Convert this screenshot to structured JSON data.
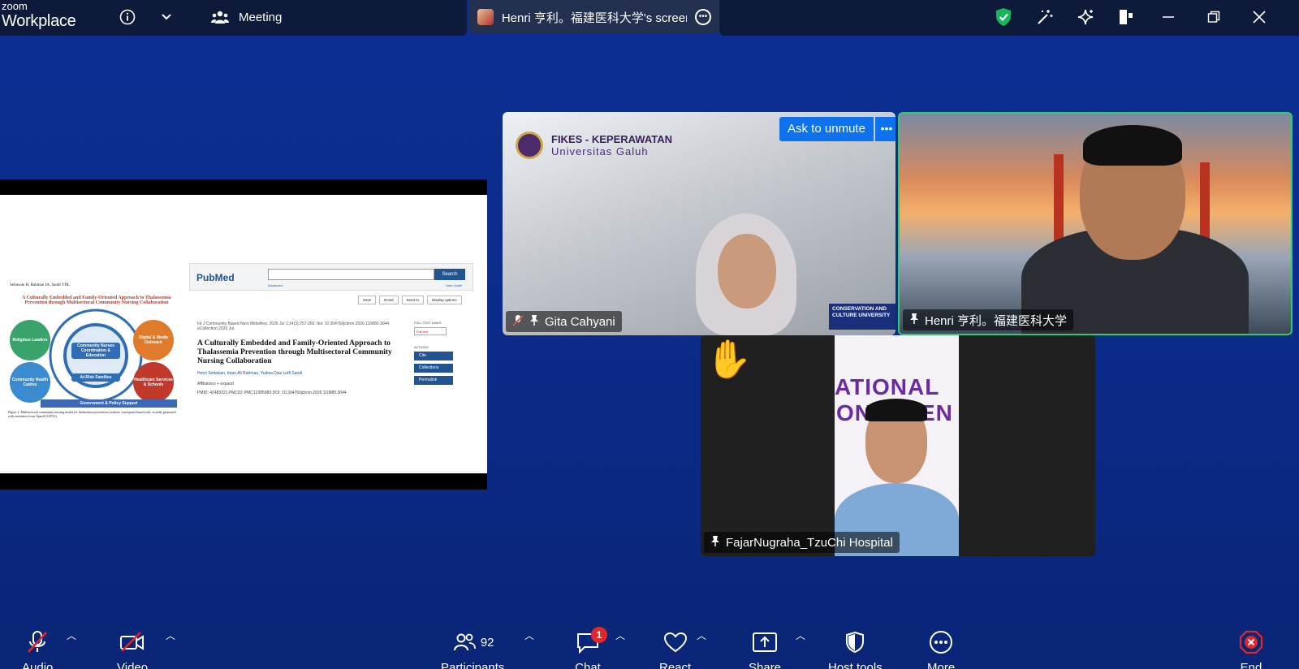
{
  "app": {
    "logo_top": "zoom",
    "logo_bottom": "Workplace"
  },
  "topbar": {
    "meeting_label": "Meeting",
    "share_tab_label": "Henri 亨利。福建医科大学's screen"
  },
  "shared_screen": {
    "figure_authors": "Setiawan H, Rahman IA, Sandi YDL",
    "figure_title": "A Culturally Embedded and Family-Oriented Approach to Thalassemia Prevention through Multisectoral Community Nursing Collaboration",
    "nodes": [
      {
        "label": "Religious Leaders",
        "color": "#3aa36b"
      },
      {
        "label": "Digital & Media Outreach",
        "color": "#e07b2c"
      },
      {
        "label": "Community Nurses Coordination & Education",
        "color": "#2f6db5"
      },
      {
        "label": "Community Health Cadres",
        "color": "#3a8bd0"
      },
      {
        "label": "At-Risk Families",
        "color": "#2f6db5"
      },
      {
        "label": "Healthcare Services & Schools",
        "color": "#c0392b"
      }
    ],
    "figure_bar": "Government & Policy Support",
    "figure_caption": "Figure 1: Multisectoral community nursing model for thalassemia prevention (authors' conceptual framework, visually generated with assistance from OpenAI GPT-4)",
    "pubmed": {
      "logo": "PubMed",
      "search_button": "Search",
      "advanced": "Advanced",
      "user_guide": "User Guide",
      "tools": [
        "Save",
        "Email",
        "Send to",
        "Display options"
      ],
      "journal_line": "Int J Community Based Nurs Midwifery. 2026 Jul 1;14(3):257-260. doi: 10.30476/ijcbnm.2026.110880.3044. eCollection 2026 Jul.",
      "title": "A Culturally Embedded and Family-Oriented Approach to Thalassemia Prevention through Multisectoral Community Nursing Collaboration",
      "authors": "Henri Setiawan, Irpan Ali Rahman, Yudisa Diaz Lutfi Sandi",
      "affiliations": "Affiliations + expand",
      "ids": "PMID: 42483321   PMCID: PMC12385983   DOI: 10.30476/ijcbnm.2026.110880.3044",
      "full_text_label": "FULL TEXT LINKS",
      "full_text_btn": "Full text",
      "actions_label": "ACTIONS",
      "actions": [
        "Cite",
        "Collections",
        "Permalink"
      ]
    }
  },
  "tiles": {
    "gita": {
      "name": "Gita Cahyani",
      "org_line1": "FIKES - KEPERAWATAN",
      "org_line2": "Universitas Galuh",
      "ask_unmute": "Ask to unmute",
      "banner": "CONSERVATION AND CULTURE UNIVERSITY"
    },
    "henri": {
      "name": "Henri 亨利。福建医科大学"
    },
    "fajar": {
      "name": "FajarNugraha_TzuChi Hospital",
      "poster_line1": "ATIONAL",
      "poster_line2": "ONFEREN"
    }
  },
  "toolbar": {
    "audio": "Audio",
    "video": "Video",
    "participants": "Participants",
    "participants_count": "92",
    "chat": "Chat",
    "chat_badge": "1",
    "react": "React",
    "share": "Share",
    "host_tools": "Host tools",
    "more": "More",
    "end": "End"
  },
  "colors": {
    "background": "#0c2f95",
    "topbar": "#0e1a3a",
    "accent": "#0e72ed",
    "active_speaker": "#2ecc71",
    "end": "#e02828"
  }
}
